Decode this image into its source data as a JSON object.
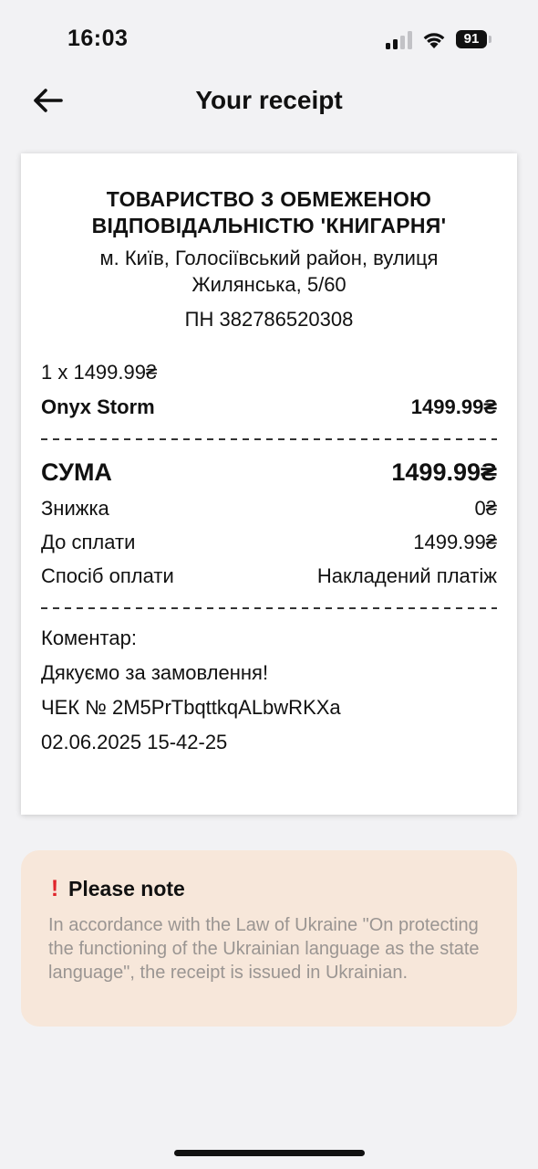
{
  "status_bar": {
    "time": "16:03",
    "battery": "91"
  },
  "header": {
    "title": "Your receipt"
  },
  "receipt": {
    "company_name": "ТОВАРИСТВО З ОБМЕЖЕНОЮ ВІДПОВІДАЛЬНІСТЮ 'КНИГАРНЯ'",
    "address": "м. Київ, Голосіївський район, вулиця Жилянська, 5/60",
    "tax_id": "ПН 382786520308",
    "item": {
      "quantity_price": "1 x 1499.99₴",
      "name": "Onyx Storm",
      "total": "1499.99₴"
    },
    "summary": {
      "sum_label": "СУМА",
      "sum_value": "1499.99₴",
      "discount_label": "Знижка",
      "discount_value": "0₴",
      "to_pay_label": "До сплати",
      "to_pay_value": "1499.99₴",
      "payment_label": "Спосіб оплати",
      "payment_value": "Накладений платіж"
    },
    "comment_label": "Коментар:",
    "thanks": "Дякуємо за замовлення!",
    "check_number": "ЧЕК № 2M5PrTbqttkqALbwRKXa",
    "datetime": "02.06.2025 15-42-25"
  },
  "note": {
    "title": "Please note",
    "text": "In accordance with the Law of Ukraine \"On protecting the functioning of the Ukrainian language as the state language\", the receipt is issued in Ukrainian."
  },
  "colors": {
    "note_bg": "#f7e7da",
    "alert_red": "#e0252b",
    "note_text": "#9a9592"
  }
}
